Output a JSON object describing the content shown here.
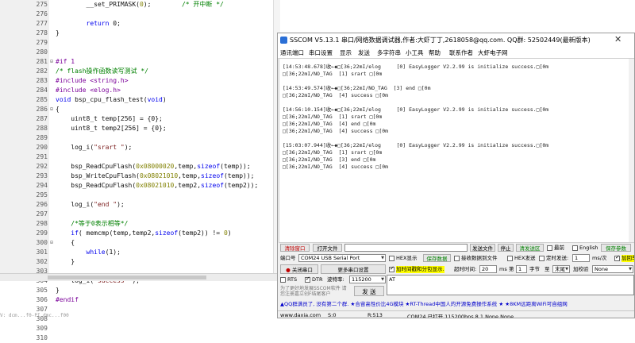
{
  "editor": {
    "lines": [
      {
        "n": "275",
        "fold": "",
        "segs": [
          {
            "t": "        __set_PRIMASK(",
            "c": ""
          },
          {
            "t": "0",
            "c": "num"
          },
          {
            "t": ");        ",
            "c": ""
          },
          {
            "t": "/* 开中断 */",
            "c": "cm"
          }
        ]
      },
      {
        "n": "276",
        "fold": "",
        "segs": [
          {
            "t": "",
            "c": ""
          }
        ]
      },
      {
        "n": "277",
        "fold": "",
        "segs": [
          {
            "t": "        ",
            "c": ""
          },
          {
            "t": "return",
            "c": "kw"
          },
          {
            "t": " 0;",
            "c": ""
          }
        ]
      },
      {
        "n": "278",
        "fold": "",
        "segs": [
          {
            "t": "}",
            "c": ""
          }
        ]
      },
      {
        "n": "279",
        "fold": "",
        "segs": [
          {
            "t": "",
            "c": ""
          }
        ]
      },
      {
        "n": "280",
        "fold": "",
        "segs": [
          {
            "t": "",
            "c": ""
          }
        ]
      },
      {
        "n": "281",
        "fold": "⊟",
        "segs": [
          {
            "t": "#if 1",
            "c": "pp"
          }
        ]
      },
      {
        "n": "282",
        "fold": "",
        "segs": [
          {
            "t": "/* flash操作函数读写测试 */",
            "c": "cm"
          }
        ]
      },
      {
        "n": "283",
        "fold": "",
        "segs": [
          {
            "t": "#include <string.h>",
            "c": "pp"
          }
        ]
      },
      {
        "n": "284",
        "fold": "",
        "segs": [
          {
            "t": "#include <elog.h>",
            "c": "pp"
          }
        ]
      },
      {
        "n": "285",
        "fold": "",
        "segs": [
          {
            "t": "void",
            "c": "kw"
          },
          {
            "t": " bsp_cpu_flash_test(",
            "c": ""
          },
          {
            "t": "void",
            "c": "kw"
          },
          {
            "t": ")",
            "c": ""
          }
        ]
      },
      {
        "n": "286",
        "fold": "⊟",
        "segs": [
          {
            "t": "{",
            "c": ""
          }
        ]
      },
      {
        "n": "287",
        "fold": "",
        "segs": [
          {
            "t": "    uint8_t temp[256] = {0};",
            "c": ""
          }
        ]
      },
      {
        "n": "288",
        "fold": "",
        "segs": [
          {
            "t": "    uint8_t temp2[256] = {0};",
            "c": ""
          }
        ]
      },
      {
        "n": "289",
        "fold": "",
        "segs": [
          {
            "t": "",
            "c": ""
          }
        ]
      },
      {
        "n": "290",
        "fold": "",
        "segs": [
          {
            "t": "    log_i(",
            "c": ""
          },
          {
            "t": "\"srart \"",
            "c": "str"
          },
          {
            "t": ");",
            "c": ""
          }
        ]
      },
      {
        "n": "291",
        "fold": "",
        "segs": [
          {
            "t": "",
            "c": ""
          }
        ]
      },
      {
        "n": "292",
        "fold": "",
        "segs": [
          {
            "t": "    bsp_ReadCpuFlash(",
            "c": ""
          },
          {
            "t": "0x08000020",
            "c": "num"
          },
          {
            "t": ",temp,",
            "c": ""
          },
          {
            "t": "sizeof",
            "c": "kw"
          },
          {
            "t": "(temp));",
            "c": ""
          }
        ]
      },
      {
        "n": "293",
        "fold": "",
        "segs": [
          {
            "t": "    bsp_WriteCpuFlash(",
            "c": ""
          },
          {
            "t": "0x08021010",
            "c": "num"
          },
          {
            "t": ",temp,",
            "c": ""
          },
          {
            "t": "sizeof",
            "c": "kw"
          },
          {
            "t": "(temp));",
            "c": ""
          }
        ]
      },
      {
        "n": "294",
        "fold": "",
        "segs": [
          {
            "t": "    bsp_ReadCpuFlash(",
            "c": ""
          },
          {
            "t": "0x08021010",
            "c": "num"
          },
          {
            "t": ",temp2,",
            "c": ""
          },
          {
            "t": "sizeof",
            "c": "kw"
          },
          {
            "t": "(temp2));",
            "c": ""
          }
        ]
      },
      {
        "n": "295",
        "fold": "",
        "segs": [
          {
            "t": "",
            "c": ""
          }
        ]
      },
      {
        "n": "296",
        "fold": "",
        "segs": [
          {
            "t": "    log_i(",
            "c": ""
          },
          {
            "t": "\"end \"",
            "c": "str"
          },
          {
            "t": ");",
            "c": ""
          }
        ]
      },
      {
        "n": "297",
        "fold": "",
        "segs": [
          {
            "t": "",
            "c": ""
          }
        ]
      },
      {
        "n": "298",
        "fold": "",
        "segs": [
          {
            "t": "    ",
            "c": ""
          },
          {
            "t": "/*等于0表示相等*/",
            "c": "cm"
          }
        ]
      },
      {
        "n": "299",
        "fold": "",
        "segs": [
          {
            "t": "    ",
            "c": ""
          },
          {
            "t": "if",
            "c": "kw"
          },
          {
            "t": "( memcmp(temp,temp2,",
            "c": ""
          },
          {
            "t": "sizeof",
            "c": "kw"
          },
          {
            "t": "(temp2)) != ",
            "c": ""
          },
          {
            "t": "0",
            "c": "num"
          },
          {
            "t": ")",
            "c": ""
          }
        ]
      },
      {
        "n": "300",
        "fold": "⊟",
        "segs": [
          {
            "t": "    {",
            "c": ""
          }
        ]
      },
      {
        "n": "301",
        "fold": "",
        "segs": [
          {
            "t": "        ",
            "c": ""
          },
          {
            "t": "while",
            "c": "kw"
          },
          {
            "t": "(1);",
            "c": ""
          }
        ]
      },
      {
        "n": "302",
        "fold": "",
        "segs": [
          {
            "t": "    }",
            "c": ""
          }
        ]
      },
      {
        "n": "303",
        "fold": "",
        "segs": [
          {
            "t": "",
            "c": ""
          }
        ]
      },
      {
        "n": "304",
        "fold": "",
        "segs": [
          {
            "t": "    log_i(",
            "c": ""
          },
          {
            "t": "\"success \"",
            "c": "str"
          },
          {
            "t": ");",
            "c": ""
          }
        ]
      },
      {
        "n": "305",
        "fold": "",
        "segs": [
          {
            "t": "}",
            "c": ""
          }
        ]
      },
      {
        "n": "306",
        "fold": "",
        "segs": [
          {
            "t": "#endif",
            "c": "pp"
          }
        ]
      },
      {
        "n": "307",
        "fold": "",
        "segs": [
          {
            "t": "",
            "c": ""
          }
        ]
      },
      {
        "n": "308",
        "fold": "",
        "segs": [
          {
            "t": "",
            "c": ""
          }
        ]
      },
      {
        "n": "309",
        "fold": "",
        "segs": [
          {
            "t": "",
            "c": ""
          }
        ]
      },
      {
        "n": "310",
        "fold": "",
        "segs": [
          {
            "t": "",
            "c": ""
          }
        ]
      }
    ],
    "status_line": "V: dcm...f0-PI dmc...f00"
  },
  "sscom": {
    "title": "SSCOM V5.13.1 串口/网络数据调试器,作者:大虾丁丁,2618058@qq.com. QQ群: 52502449(最新版本)",
    "close_glyph": "✕",
    "menu": [
      "通讯端口",
      "串口设置",
      "显示",
      "发送",
      "多字符串",
      "小工具",
      "帮助",
      "联系作者",
      "大虾电子网"
    ],
    "receive_lines": [
      "[14:53:48.678]收←◆□[36;22mI/elog     [0] EasyLogger V2.2.99 is initialize success.□[0m",
      "□[36;22mI/NO_TAG  [1] srart □[0m",
      "",
      "[14:53:49.574]收←◆□[36;22mI/NO_TAG  [3] end □[0m",
      "□[36;22mI/NO_TAG  [4] success □[0m",
      "",
      "[14:56:10.154]收←◆□[36;22mI/elog     [0] EasyLogger V2.2.99 is initialize success.□[0m",
      "□[36;22mI/NO_TAG  [1] srart □[0m",
      "□[36;22mI/NO_TAG  [4] end □[0m",
      "□[36;22mI/NO_TAG  [4] success □[0m",
      "",
      "[15:03:07.944]收←◆□[36;22mI/elog     [0] EasyLogger V2.2.99 is initialize success.□[0m",
      "□[36;22mI/NO_TAG  [1] srart □[0m",
      "□[36;22mI/NO_TAG  [3] end □[0m",
      "□[36;22mI/NO_TAG  [4] success □[0m"
    ],
    "row1": {
      "clear": "清除窗口",
      "open_file": "打开文件",
      "send_file": "发送文件",
      "stop": "停止",
      "send_area": "清发送区",
      "last": "最前",
      "english": "English",
      "save_params": "保存参数"
    },
    "row2": {
      "port_label": "端口号",
      "port_value": "COM24 USB Serial Port",
      "hex_display": "HEX显示",
      "save_data": "保存数据",
      "recv_to_file": "接收数据到文件",
      "hex_send": "HEX发送",
      "timed_send": "定时发送:",
      "interval": "1",
      "unit": "ms/次",
      "add_enter": "加回车"
    },
    "row3": {
      "close_port": "关闭串口",
      "more_settings": "更多串口设置",
      "timestamp": "加时间戳和分包显示.",
      "timeout_label": "超时时间:",
      "timeout": "20",
      "ms": "ms",
      "byte_no": "第",
      "byte_val": "1",
      "byte_unit": "字节",
      "to": "至",
      "end": "末尾",
      "checksum": "加校验",
      "check_val": "None"
    },
    "row4": {
      "rts": "RTS",
      "dtr": "DTR",
      "baud_label": "波特率:",
      "baud": "115200",
      "input_text": "AT"
    },
    "row5": {
      "promo": "为了更好地发展SSCOM软件 请您注册嘉立创F结尾客户",
      "send": "发 送"
    },
    "ticker": "▲QQ群满员了, 没有第二个群. ★合宙高性价比4G模块 ★RT-Thread中国人的开源免费操作系统 ★ ★8KM远距离WiFi可自组网",
    "status": {
      "site": "www.daxia.com",
      "s": "S:0",
      "r": "R:513",
      "port": "COM24 已打开  115200bps,8,1,None,None"
    }
  },
  "colors": {
    "accent_green": "#008000",
    "title_red": "#c00000",
    "ticker_blue": "#0000cc",
    "highlight_yellow": "#ffff00"
  }
}
